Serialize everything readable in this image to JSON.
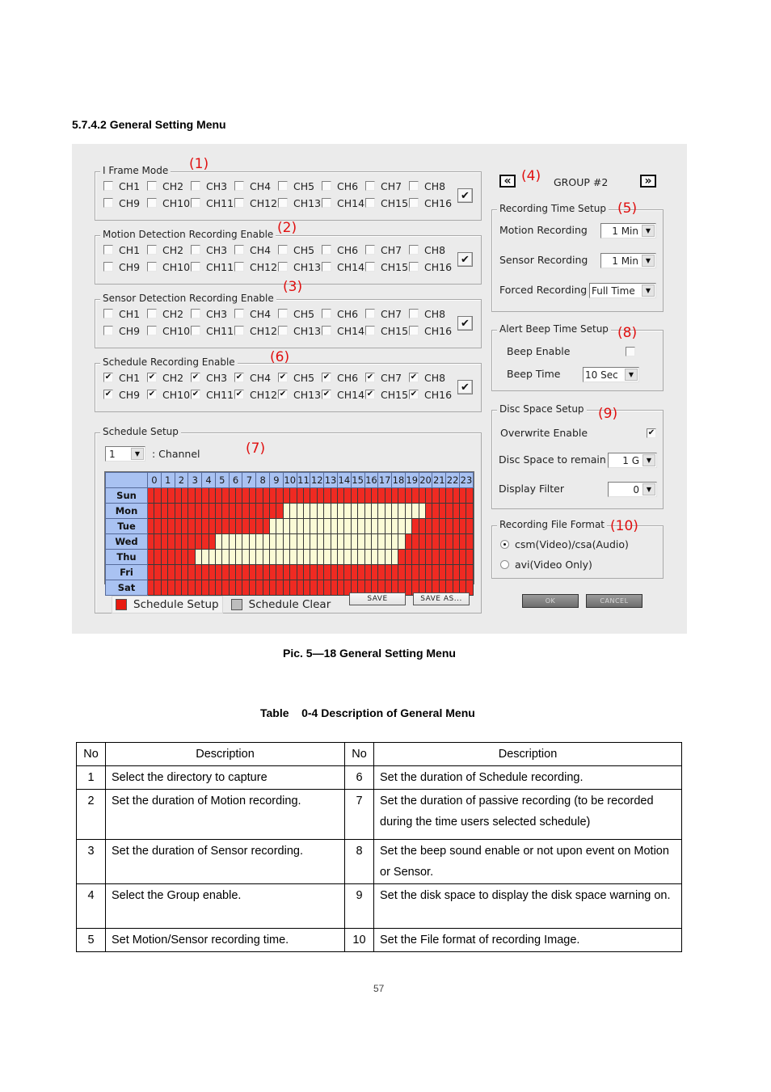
{
  "section_heading": "5.7.4.2 General Setting Menu",
  "panel": {
    "iframe_mode": {
      "legend": "I Frame Mode",
      "marker": "(1)",
      "channels": [
        "CH1",
        "CH2",
        "CH3",
        "CH4",
        "CH5",
        "CH6",
        "CH7",
        "CH8",
        "CH9",
        "CH10",
        "CH11",
        "CH12",
        "CH13",
        "CH14",
        "CH15",
        "CH16"
      ],
      "checked": [
        false,
        false,
        false,
        false,
        false,
        false,
        false,
        false,
        false,
        false,
        false,
        false,
        false,
        false,
        false,
        false
      ],
      "select_all_icon": "✔"
    },
    "motion_detection": {
      "legend": "Motion Detection Recording Enable",
      "marker": "(2)",
      "channels": [
        "CH1",
        "CH2",
        "CH3",
        "CH4",
        "CH5",
        "CH6",
        "CH7",
        "CH8",
        "CH9",
        "CH10",
        "CH11",
        "CH12",
        "CH13",
        "CH14",
        "CH15",
        "CH16"
      ],
      "checked": [
        false,
        false,
        false,
        false,
        false,
        false,
        false,
        false,
        false,
        false,
        false,
        false,
        false,
        false,
        false,
        false
      ],
      "select_all_icon": "✔"
    },
    "sensor_detection": {
      "legend": "Sensor Detection Recording Enable",
      "marker": "(3)",
      "channels": [
        "CH1",
        "CH2",
        "CH3",
        "CH4",
        "CH5",
        "CH6",
        "CH7",
        "CH8",
        "CH9",
        "CH10",
        "CH11",
        "CH12",
        "CH13",
        "CH14",
        "CH15",
        "CH16"
      ],
      "checked": [
        false,
        false,
        false,
        false,
        false,
        false,
        false,
        false,
        false,
        false,
        false,
        false,
        false,
        false,
        false,
        false
      ],
      "select_all_icon": "✔"
    },
    "schedule_recording": {
      "legend": "Schedule Recording Enable",
      "marker": "(6)",
      "channels": [
        "CH1",
        "CH2",
        "CH3",
        "CH4",
        "CH5",
        "CH6",
        "CH7",
        "CH8",
        "CH9",
        "CH10",
        "CH11",
        "CH12",
        "CH13",
        "CH14",
        "CH15",
        "CH16"
      ],
      "checked": [
        true,
        true,
        true,
        true,
        true,
        true,
        true,
        true,
        true,
        true,
        true,
        true,
        true,
        true,
        true,
        true
      ],
      "select_all_icon": "✔"
    },
    "schedule_setup": {
      "legend": "Schedule Setup",
      "marker": "(7)",
      "channel_value": "1",
      "channel_label": ": Channel",
      "hours": [
        "0",
        "1",
        "2",
        "3",
        "4",
        "5",
        "6",
        "7",
        "8",
        "9",
        "10",
        "11",
        "12",
        "13",
        "14",
        "15",
        "16",
        "17",
        "18",
        "19",
        "20",
        "21",
        "22",
        "23"
      ],
      "days": [
        "Sun",
        "Mon",
        "Tue",
        "Wed",
        "Thu",
        "Fri",
        "Sat"
      ],
      "slots_per_hour": 2,
      "scheduled_color": "#ef2a22",
      "unscheduled_color": "#fbfbd6",
      "unscheduled_ranges": {
        "Sun": [],
        "Mon": [
          [
            20,
            40
          ]
        ],
        "Tue": [
          [
            18,
            38
          ]
        ],
        "Wed": [
          [
            10,
            37
          ]
        ],
        "Thu": [
          [
            7,
            36
          ]
        ],
        "Fri": [],
        "Sat": []
      },
      "setup_label": "Schedule Setup",
      "clear_label": "Schedule Clear",
      "save_label": "SAVE",
      "save_as_label": "SAVE AS..."
    },
    "group_nav": {
      "prev_icon": "«",
      "next_icon": "»",
      "marker": "(4)",
      "group_label": "GROUP #2"
    },
    "recording_time": {
      "legend": "Recording Time Setup",
      "marker": "(5)",
      "motion_label": "Motion Recording",
      "motion_value": "1  Min",
      "sensor_label": "Sensor Recording",
      "sensor_value": "1  Min",
      "forced_label": "Forced Recording",
      "forced_value": "Full Time"
    },
    "alert_beep": {
      "legend": "Alert Beep Time Setup",
      "marker": "(8)",
      "enable_label": "Beep Enable",
      "enable_checked": false,
      "time_label": "Beep Time",
      "time_value": "10 Sec"
    },
    "disc_space": {
      "legend": "Disc Space Setup",
      "marker": "(9)",
      "overwrite_label": "Overwrite Enable",
      "overwrite_checked": true,
      "remain_label": "Disc Space to remain",
      "remain_value": "1 G",
      "filter_label": "Display Filter",
      "filter_value": "0"
    },
    "file_format": {
      "legend": "Recording File Format",
      "marker": "(10)",
      "options": [
        "csm(Video)/csa(Audio)",
        "avi(Video Only)"
      ],
      "selected": 0
    },
    "ok_label": "OK",
    "cancel_label": "CANCEL",
    "dropdown_icon": "▼",
    "check_icon": "✔"
  },
  "figure_caption": "Pic. 5—18 General Setting Menu",
  "table_caption": "Table    0-4 Description of General Menu",
  "table": {
    "headers": [
      "No",
      "Description",
      "No",
      "Description"
    ],
    "rows": [
      {
        "no_left": "1",
        "desc_left": "Select the directory to capture",
        "no_right": "6",
        "desc_right": "Set the duration of Schedule recording."
      },
      {
        "no_left": "2",
        "desc_left": "Set the duration of Motion recording.",
        "no_right": "7",
        "desc_right": "Set the duration of passive recording (to be recorded during the time users selected schedule)"
      },
      {
        "no_left": "3",
        "desc_left": "Set the duration of Sensor recording.",
        "no_right": "8",
        "desc_right": "Set the beep sound enable or not upon event on Motion or Sensor."
      },
      {
        "no_left": "4",
        "desc_left": "Select the Group enable.",
        "no_right": "9",
        "desc_right": "Set the disk space to display the disk space warning on."
      },
      {
        "no_left": "5",
        "desc_left": "Set Motion/Sensor recording time.",
        "no_right": "10",
        "desc_right": "Set the File format of recording Image."
      }
    ]
  },
  "page_number": "57"
}
